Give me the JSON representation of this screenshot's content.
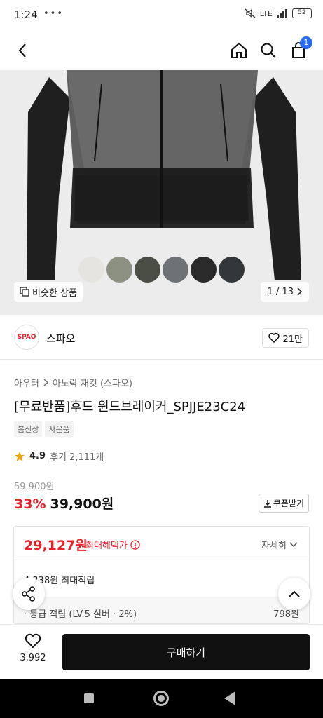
{
  "status": {
    "time": "1:24",
    "left_icons": "•••",
    "network": "LTE",
    "battery": "52"
  },
  "header": {
    "cart_count": "1"
  },
  "product": {
    "similar_label": "비슷한 상품",
    "page_indicator": "1 / 13",
    "swatches": [
      "#e6e4df",
      "#8b9080",
      "#4a4e45",
      "#6e7277",
      "#2a2a2a",
      "#34373a"
    ]
  },
  "brand": {
    "logo_text": "SPAO",
    "name": "스파오",
    "like_count": "21만"
  },
  "breadcrumb": {
    "category": "아우터",
    "subcategory": "아노락 재킷 (스파오)"
  },
  "title": "[무료반품]후드 윈드브레이커_SPJJE23C24",
  "tags": [
    "봄신상",
    "사은품"
  ],
  "rating": {
    "value": "4.9",
    "reviews": "후기 2,111개"
  },
  "price": {
    "original": "59,900원",
    "discount": "33%",
    "sale": "39,900원",
    "coupon_label": "쿠폰받기"
  },
  "benefit": {
    "max_price": "29,127원",
    "max_label": "최대혜택가",
    "detail_label": "자세히",
    "points_total": "4,338원 최대적립",
    "grade_label": "· 등급 적립 (LV.5 실버 · 2%)",
    "grade_value": "798원"
  },
  "bottom": {
    "wish_count": "3,992",
    "buy_label": "구매하기"
  },
  "colors": {
    "accent_red": "#e8202a",
    "badge_blue": "#2d6cf6",
    "buy_black": "#111111"
  }
}
